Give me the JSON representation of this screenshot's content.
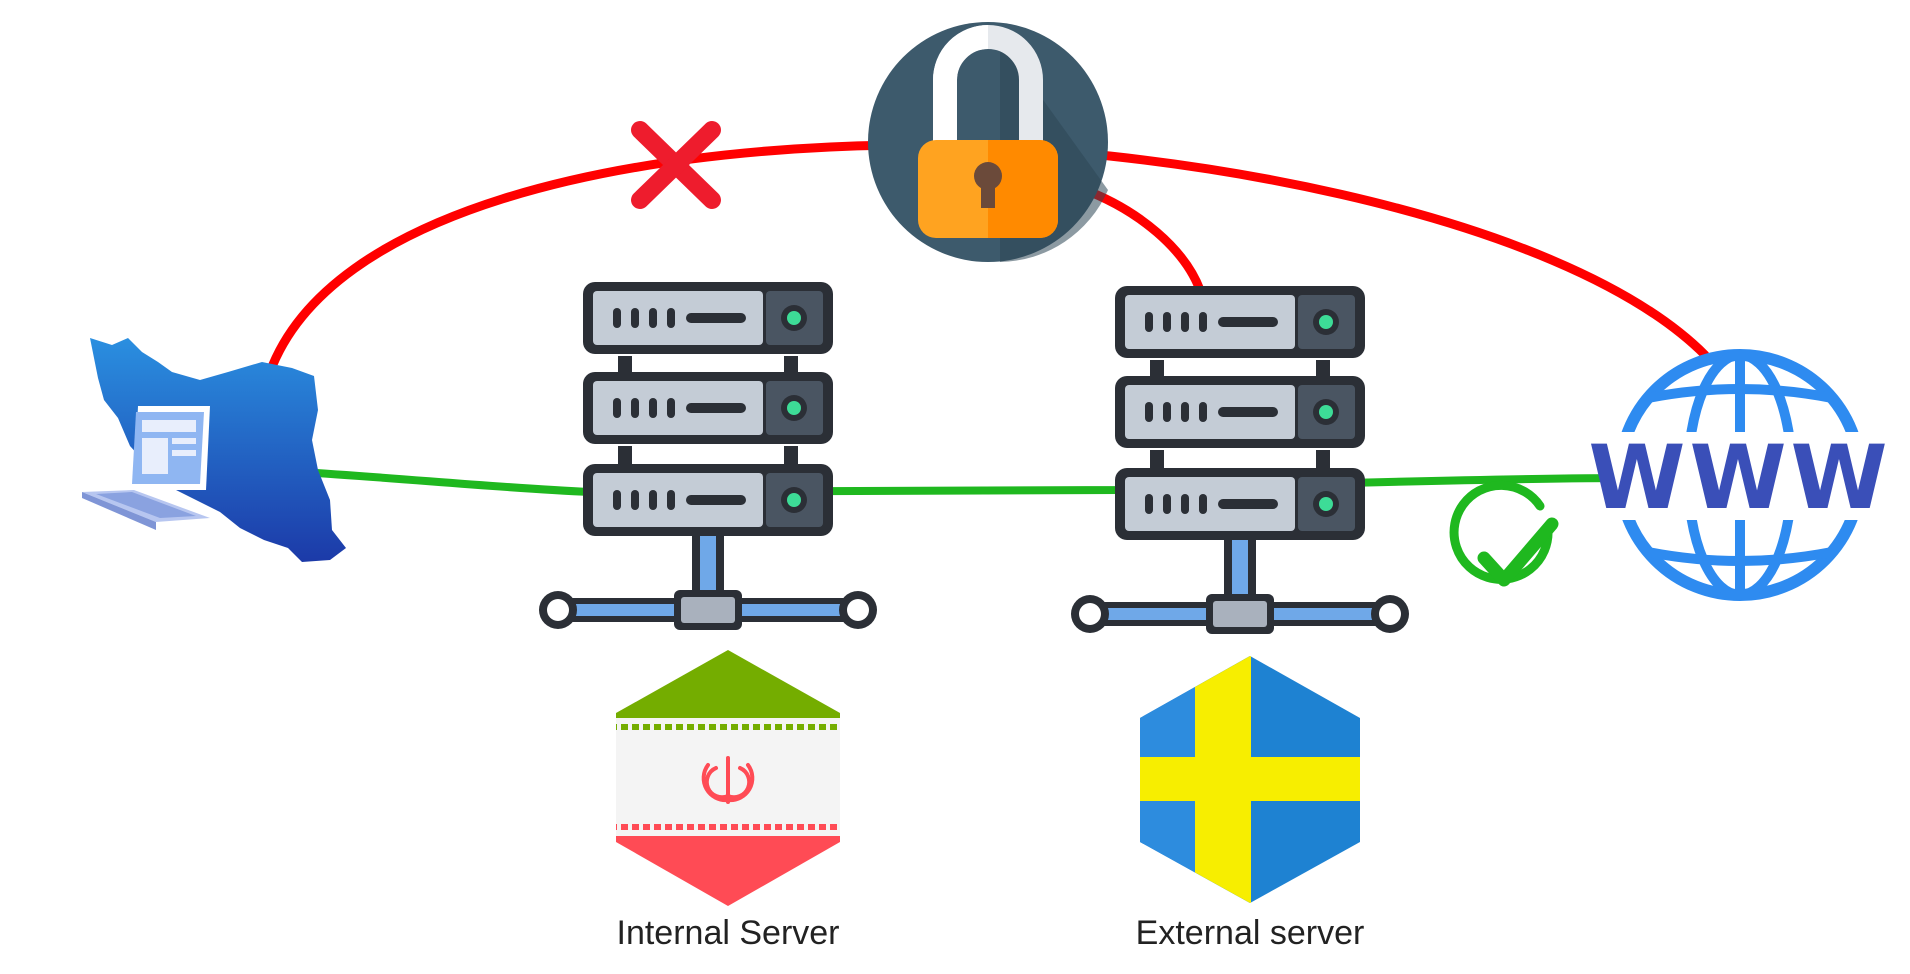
{
  "labels": {
    "internal_server": "Internal Server",
    "external_server": "External server",
    "www": "WWW"
  },
  "icons": {
    "client": "iran-map-laptop-icon",
    "lock": "padlock-icon",
    "blocked": "red-x-icon",
    "allowed": "green-check-icon",
    "web": "www-globe-icon",
    "internal_server": "server-rack-icon",
    "external_server": "server-rack-icon",
    "internal_flag": "iran-flag-hexagon",
    "external_flag": "sweden-flag-hexagon"
  },
  "colors": {
    "blocked_path": "#ff0000",
    "allowed_path": "#1fb81f",
    "lock_circle": "#3d5a6c",
    "lock_body": "#ffa320",
    "globe": "#2e8bf0",
    "www_text": "#3a4fb8",
    "iran_green": "#74ad00",
    "iran_red": "#ff4b55",
    "sweden_blue": "#1e82d2",
    "sweden_yellow": "#f7ee00"
  }
}
